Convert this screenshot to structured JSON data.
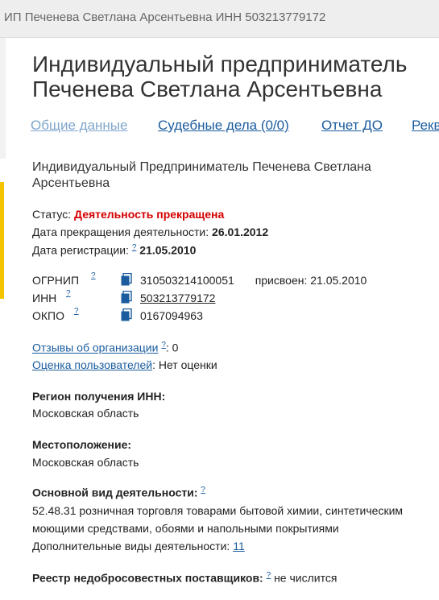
{
  "topbar": {
    "title": "ИП Печенева Светлана Арсентьевна ИНН 503213779172"
  },
  "heading": {
    "line1": "Индивидуальный предприниматель",
    "line2": "Печенева Светлана Арсентьевна"
  },
  "tabs": [
    {
      "label": "Общие данные"
    },
    {
      "label": "Судебные дела (0/0)"
    },
    {
      "label": "Отчет ДО"
    },
    {
      "label": "Рекв"
    }
  ],
  "full_name": "Индивидуальный Предприниматель Печенева Светлана Арсентьевна",
  "status": {
    "label": "Статус:",
    "value": "Деятельность прекращена"
  },
  "termination": {
    "label": "Дата прекращения деятельности:",
    "value": "26.01.2012"
  },
  "registration": {
    "label": "Дата регистрации:",
    "help": "?",
    "value": "21.05.2010"
  },
  "codes": {
    "ogrnip": {
      "label": "ОГРНИП",
      "help": "?",
      "value": "310503214100051",
      "assigned": "присвоен: 21.05.2010"
    },
    "inn": {
      "label": "ИНН",
      "help": "?",
      "value": "503213779172"
    },
    "okpo": {
      "label": "ОКПО",
      "help": "?",
      "value": "0167094963"
    }
  },
  "reviews": {
    "link": "Отзывы об организации",
    "help": "?",
    "value": ": 0"
  },
  "rating": {
    "link": "Оценка пользователей",
    "value": ": Нет оценки"
  },
  "region": {
    "title": "Регион получения ИНН:",
    "value": "Московская область"
  },
  "location": {
    "title": "Местоположение:",
    "value": "Московская область"
  },
  "activity": {
    "title": "Основной вид деятельности:",
    "help": "?",
    "line1": "52.48.31 розничная торговля товарами бытовой химии, синтетическим",
    "line2": "моющими средствами, обоями и напольными покрытиями",
    "extra_label": "Дополнительные виды деятельности:",
    "extra_count": "11"
  },
  "registry": {
    "title": "Реестр недобросовестных поставщиков:",
    "help": "?",
    "value": "не числится"
  },
  "colors": {
    "link": "#1a5c9e",
    "status_red": "#d40000",
    "accent_yellow": "#f5c400"
  }
}
